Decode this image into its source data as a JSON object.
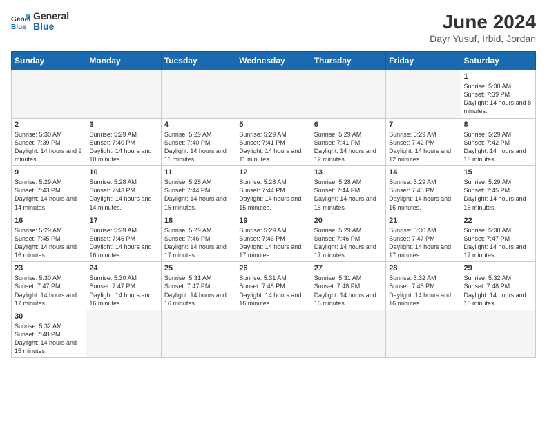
{
  "logo": {
    "general": "General",
    "blue": "Blue"
  },
  "title": "June 2024",
  "subtitle": "Dayr Yusuf, Irbid, Jordan",
  "weekdays": [
    "Sunday",
    "Monday",
    "Tuesday",
    "Wednesday",
    "Thursday",
    "Friday",
    "Saturday"
  ],
  "days": [
    {
      "num": "",
      "empty": true
    },
    {
      "num": "",
      "empty": true
    },
    {
      "num": "",
      "empty": true
    },
    {
      "num": "",
      "empty": true
    },
    {
      "num": "",
      "empty": true
    },
    {
      "num": "",
      "empty": true
    },
    {
      "num": "1",
      "sunrise": "5:30 AM",
      "sunset": "7:39 PM",
      "daylight": "14 hours and 8 minutes."
    },
    {
      "num": "2",
      "sunrise": "5:30 AM",
      "sunset": "7:39 PM",
      "daylight": "14 hours and 9 minutes."
    },
    {
      "num": "3",
      "sunrise": "5:29 AM",
      "sunset": "7:40 PM",
      "daylight": "14 hours and 10 minutes."
    },
    {
      "num": "4",
      "sunrise": "5:29 AM",
      "sunset": "7:40 PM",
      "daylight": "14 hours and 11 minutes."
    },
    {
      "num": "5",
      "sunrise": "5:29 AM",
      "sunset": "7:41 PM",
      "daylight": "14 hours and 11 minutes."
    },
    {
      "num": "6",
      "sunrise": "5:29 AM",
      "sunset": "7:41 PM",
      "daylight": "14 hours and 12 minutes."
    },
    {
      "num": "7",
      "sunrise": "5:29 AM",
      "sunset": "7:42 PM",
      "daylight": "14 hours and 12 minutes."
    },
    {
      "num": "8",
      "sunrise": "5:29 AM",
      "sunset": "7:42 PM",
      "daylight": "14 hours and 13 minutes."
    },
    {
      "num": "9",
      "sunrise": "5:29 AM",
      "sunset": "7:43 PM",
      "daylight": "14 hours and 14 minutes."
    },
    {
      "num": "10",
      "sunrise": "5:28 AM",
      "sunset": "7:43 PM",
      "daylight": "14 hours and 14 minutes."
    },
    {
      "num": "11",
      "sunrise": "5:28 AM",
      "sunset": "7:44 PM",
      "daylight": "14 hours and 15 minutes."
    },
    {
      "num": "12",
      "sunrise": "5:28 AM",
      "sunset": "7:44 PM",
      "daylight": "14 hours and 15 minutes."
    },
    {
      "num": "13",
      "sunrise": "5:28 AM",
      "sunset": "7:44 PM",
      "daylight": "14 hours and 15 minutes."
    },
    {
      "num": "14",
      "sunrise": "5:29 AM",
      "sunset": "7:45 PM",
      "daylight": "14 hours and 16 minutes."
    },
    {
      "num": "15",
      "sunrise": "5:29 AM",
      "sunset": "7:45 PM",
      "daylight": "14 hours and 16 minutes."
    },
    {
      "num": "16",
      "sunrise": "5:29 AM",
      "sunset": "7:45 PM",
      "daylight": "14 hours and 16 minutes."
    },
    {
      "num": "17",
      "sunrise": "5:29 AM",
      "sunset": "7:46 PM",
      "daylight": "14 hours and 16 minutes."
    },
    {
      "num": "18",
      "sunrise": "5:29 AM",
      "sunset": "7:46 PM",
      "daylight": "14 hours and 17 minutes."
    },
    {
      "num": "19",
      "sunrise": "5:29 AM",
      "sunset": "7:46 PM",
      "daylight": "14 hours and 17 minutes."
    },
    {
      "num": "20",
      "sunrise": "5:29 AM",
      "sunset": "7:46 PM",
      "daylight": "14 hours and 17 minutes."
    },
    {
      "num": "21",
      "sunrise": "5:30 AM",
      "sunset": "7:47 PM",
      "daylight": "14 hours and 17 minutes."
    },
    {
      "num": "22",
      "sunrise": "5:30 AM",
      "sunset": "7:47 PM",
      "daylight": "14 hours and 17 minutes."
    },
    {
      "num": "23",
      "sunrise": "5:30 AM",
      "sunset": "7:47 PM",
      "daylight": "14 hours and 17 minutes."
    },
    {
      "num": "24",
      "sunrise": "5:30 AM",
      "sunset": "7:47 PM",
      "daylight": "14 hours and 16 minutes."
    },
    {
      "num": "25",
      "sunrise": "5:31 AM",
      "sunset": "7:47 PM",
      "daylight": "14 hours and 16 minutes."
    },
    {
      "num": "26",
      "sunrise": "5:31 AM",
      "sunset": "7:48 PM",
      "daylight": "14 hours and 16 minutes."
    },
    {
      "num": "27",
      "sunrise": "5:31 AM",
      "sunset": "7:48 PM",
      "daylight": "14 hours and 16 minutes."
    },
    {
      "num": "28",
      "sunrise": "5:32 AM",
      "sunset": "7:48 PM",
      "daylight": "14 hours and 16 minutes."
    },
    {
      "num": "29",
      "sunrise": "5:32 AM",
      "sunset": "7:48 PM",
      "daylight": "14 hours and 15 minutes."
    },
    {
      "num": "30",
      "sunrise": "5:32 AM",
      "sunset": "7:48 PM",
      "daylight": "14 hours and 15 minutes."
    },
    {
      "num": "",
      "empty": true
    },
    {
      "num": "",
      "empty": true
    },
    {
      "num": "",
      "empty": true
    },
    {
      "num": "",
      "empty": true
    },
    {
      "num": "",
      "empty": true
    },
    {
      "num": "",
      "empty": true
    }
  ]
}
